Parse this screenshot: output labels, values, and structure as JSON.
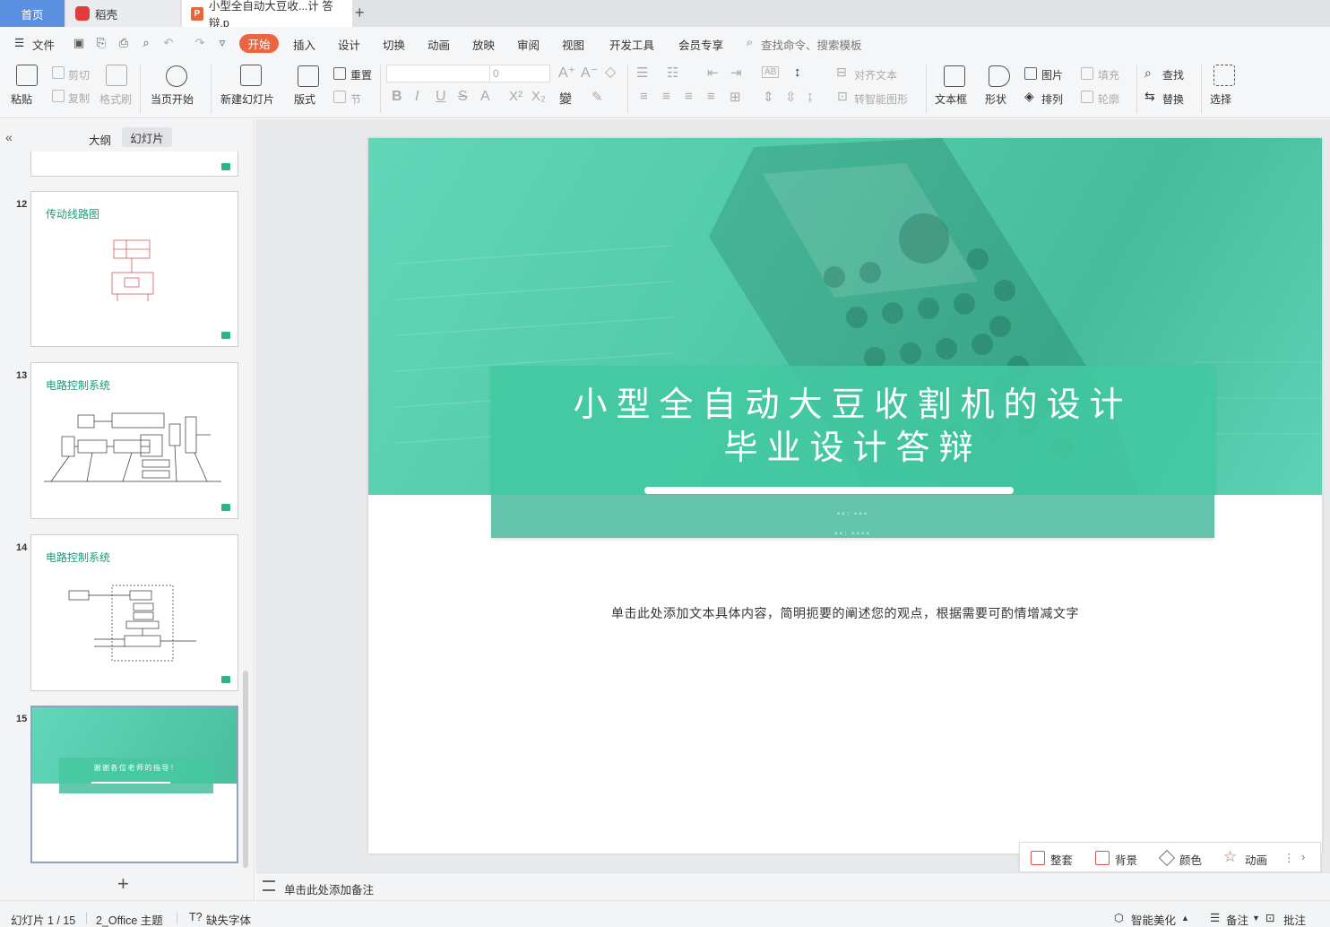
{
  "tabs": {
    "home": "首页",
    "daoke": "稻壳",
    "document": "小型全自动大豆收...计 答辩.p"
  },
  "menu": {
    "file": "文件",
    "items": [
      "开始",
      "插入",
      "设计",
      "切换",
      "动画",
      "放映",
      "审阅",
      "视图",
      "开发工具",
      "会员专享"
    ],
    "search_placeholder": "查找命令、搜索模板"
  },
  "ribbon": {
    "paste": "粘贴",
    "cut": "剪切",
    "copy": "复制",
    "format_painter": "格式刷",
    "from_first": "当页开始",
    "new_slide": "新建幻灯片",
    "layout": "版式",
    "reset": "重置",
    "section": "节",
    "font_size": "0",
    "align_text": "对齐文本",
    "smart_shape": "转智能图形",
    "textbox": "文本框",
    "shape": "形状",
    "picture": "图片",
    "fill": "填充",
    "arrange": "排列",
    "outline": "轮廓",
    "find": "查找",
    "replace": "替换",
    "select": "选择"
  },
  "left_panel": {
    "outline_tab": "大纲",
    "slides_tab": "幻灯片",
    "thumbnails": [
      {
        "num": "12",
        "title": "传动线路图"
      },
      {
        "num": "13",
        "title": "电路控制系统"
      },
      {
        "num": "14",
        "title": "电路控制系统"
      },
      {
        "num": "15",
        "title": "谢谢各位老师的指导！"
      }
    ]
  },
  "slide": {
    "title_line1": "小型全自动大豆收割机的设计",
    "title_line2": "毕业设计答辩",
    "author_line1": "××：×××",
    "author_line2": "××：××××",
    "body": "单击此处添加文本具体内容，简明扼要的阐述您的观点，根据需要可酌情增减文字"
  },
  "float_toolbar": {
    "set": "整套",
    "background": "背景",
    "color": "颜色",
    "animation": "动画"
  },
  "notes_placeholder": "单击此处添加备注",
  "status": {
    "slide_counter": "幻灯片 1 / 15",
    "theme": "2_Office 主题",
    "missing_font": "缺失字体",
    "beautify": "智能美化",
    "notes": "备注",
    "comments": "批注"
  },
  "colors": {
    "accent_orange": "#ea6540",
    "slide_teal": "#4fc9a7",
    "home_tab_blue": "#5b8fe0"
  }
}
